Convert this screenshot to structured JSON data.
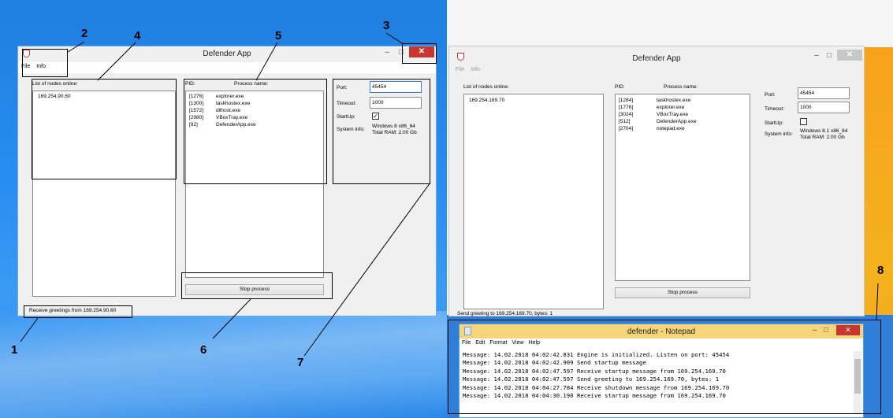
{
  "left_window": {
    "title": "Defender App",
    "menu": [
      "File",
      "Info"
    ],
    "nodes_label": "List of nodes online:",
    "nodes": [
      "169.254.90.60"
    ],
    "pid_header": "PID:",
    "process_header": "Process name:",
    "processes": [
      {
        "pid": "[1276]",
        "name": "explorer.exe"
      },
      {
        "pid": "[1300]",
        "name": "taskhostex.exe"
      },
      {
        "pid": "[1572]",
        "name": "dllhost.exe"
      },
      {
        "pid": "[2980]",
        "name": "VBoxTray.exe"
      },
      {
        "pid": "[92]",
        "name": "DefenderApp.exe"
      }
    ],
    "port_label": "Port:",
    "port_value": "45454",
    "timeout_label": "Timeout:",
    "timeout_value": "1000",
    "startup_label": "StartUp:",
    "startup_mark": "✓",
    "sysinfo_label": "System info:",
    "sysinfo_os": "Windows 8 x86_64",
    "sysinfo_ram": "Total RAM: 2.00 Gb",
    "stop_button": "Stop process",
    "status": "Receive greetings from 169.254.90.60"
  },
  "right_window": {
    "title": "Defender App",
    "menu": [
      "File",
      "Info"
    ],
    "nodes_label": "List of nodes online:",
    "nodes": [
      "169.254.169.70"
    ],
    "pid_header": "PID:",
    "process_header": "Process name:",
    "processes": [
      {
        "pid": "[1284]",
        "name": "taskhostex.exe"
      },
      {
        "pid": "[1776]",
        "name": "explorer.exe"
      },
      {
        "pid": "[3024]",
        "name": "VBoxTray.exe"
      },
      {
        "pid": "[512]",
        "name": "DefenderApp.exe"
      },
      {
        "pid": "[2704]",
        "name": "notepad.exe"
      }
    ],
    "port_label": "Port:",
    "port_value": "45454",
    "timeout_label": "Timeout:",
    "timeout_value": "1000",
    "startup_label": "StartUp:",
    "sysinfo_label": "System info:",
    "sysinfo_os": "Windows 8.1 x86_64",
    "sysinfo_ram": "Total RAM: 2.00 Gb",
    "stop_button": "Stop process",
    "status": "Send greeting to 169.254.169.70, bytes: 1"
  },
  "notepad": {
    "title": "defender - Notepad",
    "menu": [
      "File",
      "Edit",
      "Format",
      "View",
      "Help"
    ],
    "lines": [
      "Message: 14.02.2018 04:02:42.831 Engine is initialized. Listen on port: 45454",
      "Message: 14.02.2018 04:02:42.909 Send startup message",
      "Message: 14.02.2018 04:02:47.597 Receive startup message from 169.254.169.70",
      "Message: 14.02.2018 04:02:47.597 Send greeting to 169.254.169.70, bytes: 1",
      "Message: 14.02.2018 04:04:27.784 Receive shutdown message from 169.254.169.70",
      "Message: 14.02.2018 04:04:30.190 Receive startup message from 169.254.169.70"
    ]
  },
  "annotations": [
    "1",
    "2",
    "3",
    "4",
    "5",
    "6",
    "7",
    "8"
  ],
  "window_controls": {
    "minimize": "–",
    "maximize": "□",
    "close": "✕"
  },
  "icons": {
    "app": "shield-icon",
    "notepad": "notepad-icon"
  },
  "colors": {
    "close_button": "#c7372f",
    "desktop_blue": "#2b8df0",
    "accent_orange": "#f4b21e"
  }
}
